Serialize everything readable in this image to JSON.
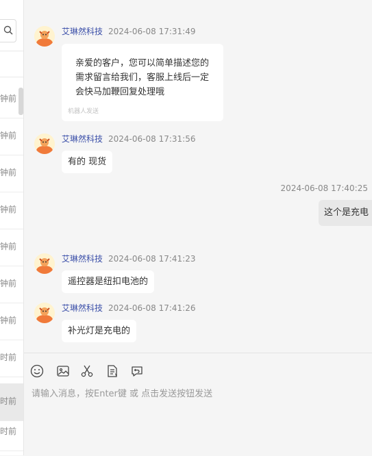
{
  "sidebar": {
    "search_icon": "search-icon",
    "items": [
      {
        "time": "钟前",
        "active": false
      },
      {
        "time": "钟前",
        "active": false
      },
      {
        "time": "钟前",
        "active": false
      },
      {
        "time": "钟前",
        "active": false
      },
      {
        "time": "钟前",
        "active": false
      },
      {
        "time": "钟前",
        "active": false
      },
      {
        "time": "钟前",
        "active": false
      },
      {
        "time": "时前",
        "active": false
      },
      {
        "time": "时前",
        "active": true
      },
      {
        "time": "时前",
        "active": false
      }
    ]
  },
  "messages": [
    {
      "sender": "艾琳然科技",
      "timestamp": "2024-06-08 17:31:49",
      "text": "亲爱的客户，您可以简单描述您的需求留言给我们，客服上线后一定会快马加鞭回复处理哦",
      "note": "机器人发送"
    },
    {
      "sender": "艾琳然科技",
      "timestamp": "2024-06-08 17:31:56",
      "text": "有的 现货"
    },
    {
      "sender": "艾琳然科技",
      "timestamp": "2024-06-08 17:41:23",
      "text": "遥控器是纽扣电池的"
    },
    {
      "sender": "艾琳然科技",
      "timestamp": "2024-06-08 17:41:26",
      "text": "补光灯是充电的"
    }
  ],
  "outgoing": {
    "timestamp": "2024-06-08 17:40:25",
    "text": "这个是充电"
  },
  "composer": {
    "tools": [
      "emoji-icon",
      "image-icon",
      "scissors-icon",
      "document-icon",
      "revoke-icon"
    ],
    "placeholder": "请输入消息，按Enter键 或 点击发送按钮发送"
  },
  "colors": {
    "sender": "#3a4ea8",
    "timestamp": "#888888",
    "background": "#f5f5f5",
    "bubble": "#ffffff",
    "avatar_accent": "#f07a3a"
  }
}
